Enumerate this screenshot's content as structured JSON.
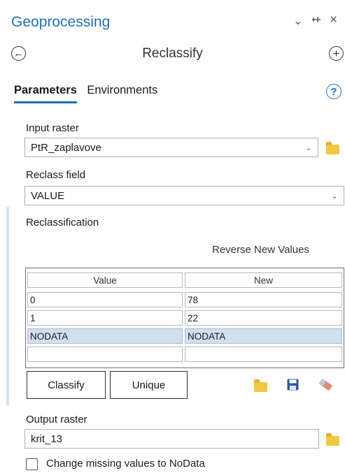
{
  "header": {
    "title": "Geoprocessing",
    "tool_name": "Reclassify",
    "controls": {
      "dropdown_glyph": "⌄",
      "pin_glyph": "⊣",
      "close_glyph": "×"
    },
    "back_glyph": "←",
    "add_glyph": "+"
  },
  "tabs": [
    {
      "label": "Parameters",
      "active": true
    },
    {
      "label": "Environments",
      "active": false
    }
  ],
  "help_glyph": "?",
  "input_raster": {
    "label": "Input raster",
    "value": "PtR_zaplavove"
  },
  "reclass_field": {
    "label": "Reclass field",
    "value": "VALUE"
  },
  "reclassification": {
    "label": "Reclassification",
    "reverse_label": "Reverse New Values",
    "columns": [
      "Value",
      "New"
    ],
    "rows": [
      {
        "value": "0",
        "new": "78",
        "selected": false
      },
      {
        "value": "1",
        "new": "22",
        "selected": false
      },
      {
        "value": "NODATA",
        "new": "NODATA",
        "selected": true
      },
      {
        "value": "",
        "new": "",
        "selected": false
      }
    ],
    "classify_label": "Classify",
    "unique_label": "Unique"
  },
  "output_raster": {
    "label": "Output raster",
    "value": "krit_13"
  },
  "missing_values": {
    "label": "Change missing values to NoData",
    "checked": false
  },
  "colors": {
    "accent": "#1f6fc2",
    "selected_row": "#cfe0f2",
    "folder": "#f3c742",
    "save_icon": "#2b5aa8",
    "eraser_icon": "#e0897a"
  },
  "icons": [
    "dropdown-icon",
    "pin-icon",
    "close-icon",
    "back-icon",
    "add-icon",
    "help-icon",
    "folder-icon",
    "save-icon",
    "eraser-icon",
    "chevron-down-icon"
  ]
}
